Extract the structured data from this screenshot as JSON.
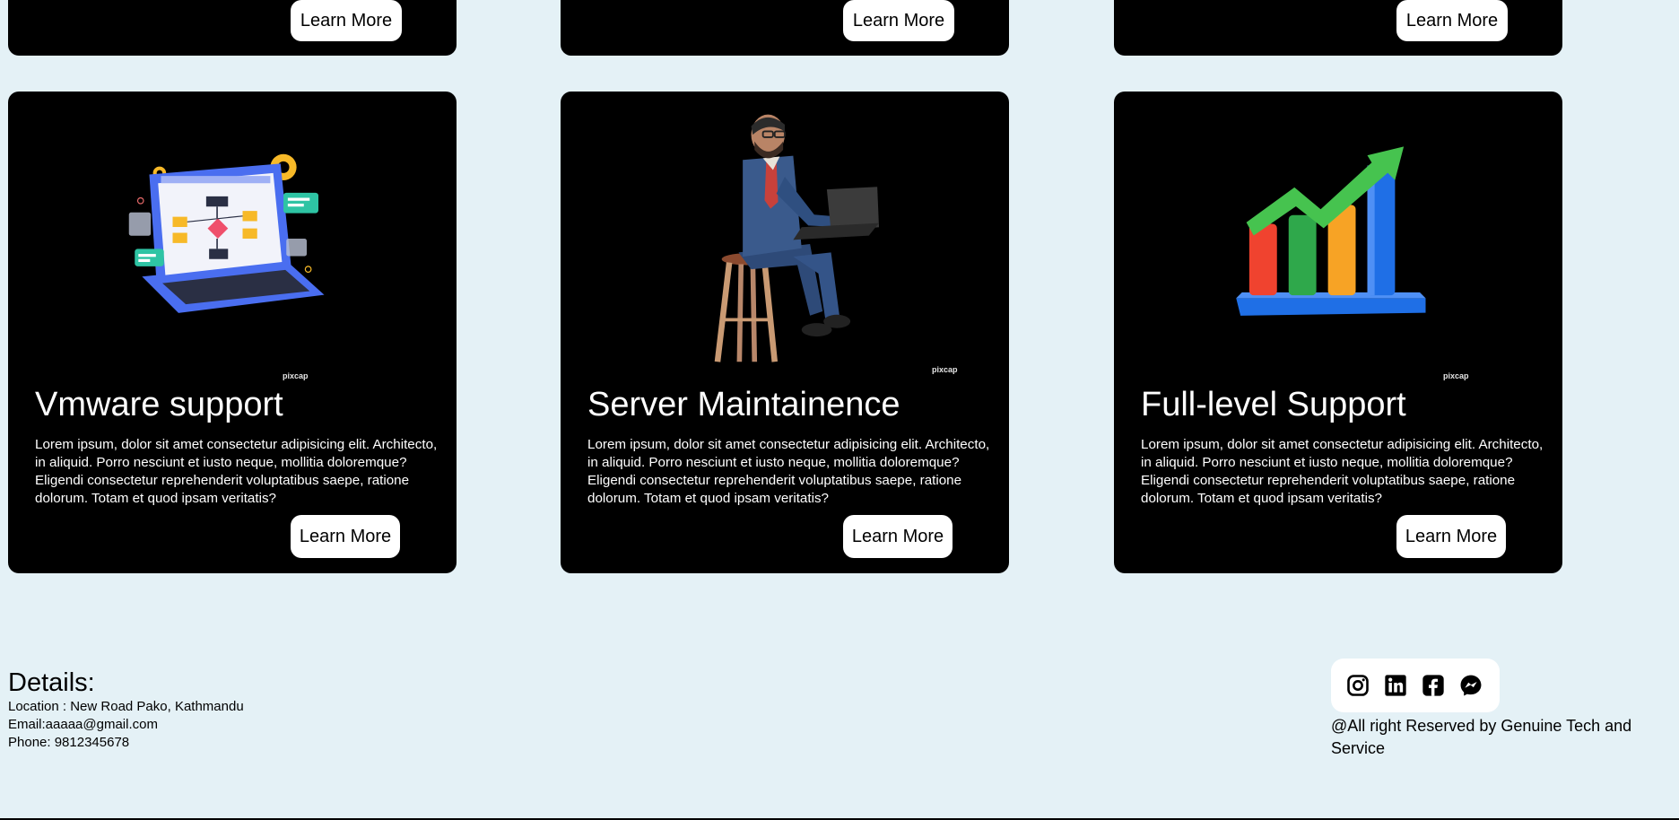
{
  "top_cards": [
    {
      "button_label": "Learn More"
    },
    {
      "button_label": "Learn More"
    },
    {
      "button_label": "Learn More"
    }
  ],
  "cards": [
    {
      "title": "Vmware support",
      "description": "Lorem ipsum, dolor sit amet consectetur adipisicing elit. Architecto, in aliquid. Porro nesciunt et iusto neque, mollitia doloremque? Eligendi consectetur reprehenderit voluptatibus saepe, ratione dolorum. Totam et quod ipsam veritatis?",
      "button_label": "Learn More",
      "watermark": "pixcap"
    },
    {
      "title": "Server Maintainence",
      "description": "Lorem ipsum, dolor sit amet consectetur adipisicing elit. Architecto, in aliquid. Porro nesciunt et iusto neque, mollitia doloremque? Eligendi consectetur reprehenderit voluptatibus saepe, ratione dolorum. Totam et quod ipsam veritatis?",
      "button_label": "Learn More",
      "watermark": "pixcap"
    },
    {
      "title": "Full-level Support",
      "description": "Lorem ipsum, dolor sit amet consectetur adipisicing elit. Architecto, in aliquid. Porro nesciunt et iusto neque, mollitia doloremque? Eligendi consectetur reprehenderit voluptatibus saepe, ratione dolorum. Totam et quod ipsam veritatis?",
      "button_label": "Learn More",
      "watermark": "pixcap"
    }
  ],
  "footer": {
    "details_heading": "Details:",
    "location": "Location : New Road Pako, Kathmandu",
    "email": "Email:aaaaa@gmail.com",
    "phone": "Phone: 9812345678",
    "social_icons": [
      "instagram-icon",
      "linkedin-icon",
      "facebook-icon",
      "messenger-icon"
    ],
    "copyright": "@All right Reserved by Genuine Tech and Service"
  },
  "colors": {
    "page_background": "#e4f1f6",
    "card_background": "#000000",
    "button_background": "#ffffff"
  }
}
